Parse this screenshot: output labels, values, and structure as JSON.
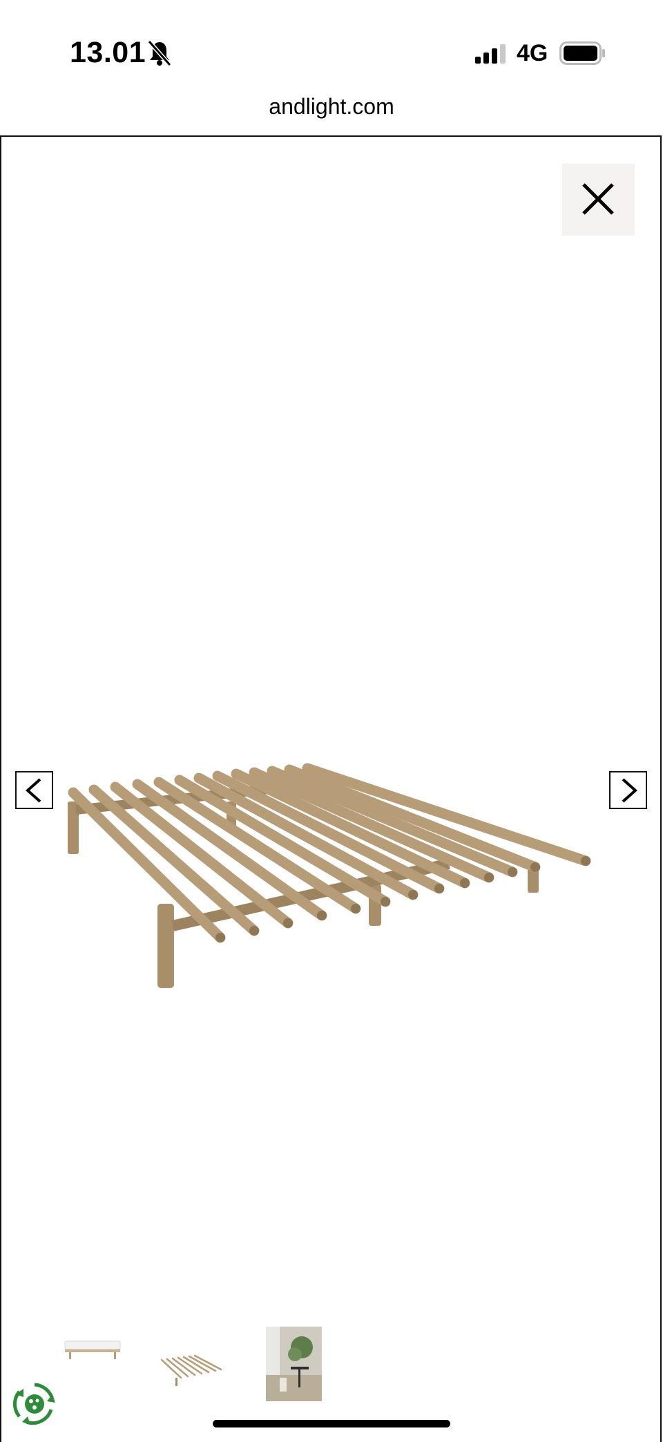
{
  "status_bar": {
    "time": "13.01",
    "network": "4G",
    "icons": [
      "bell-muted-icon",
      "signal-bars-icon",
      "battery-icon"
    ]
  },
  "browser": {
    "url": "andlight.com"
  },
  "gallery": {
    "icons": [
      "close-icon",
      "chevron-left-icon",
      "chevron-right-icon"
    ],
    "product_image": "wooden-slatted-bed-frame",
    "thumbnails": [
      {
        "depicts": "bed-frame-with-mattress"
      },
      {
        "depicts": "wooden-slatted-bed-frame"
      },
      {
        "depicts": "room-scene-with-plant"
      }
    ]
  },
  "badge": {
    "icon": "eco-recycle-badge-icon"
  },
  "colors": {
    "wood": "#b69d78",
    "wood_dark": "#8e7755",
    "close_bg": "#f4f3f1"
  }
}
